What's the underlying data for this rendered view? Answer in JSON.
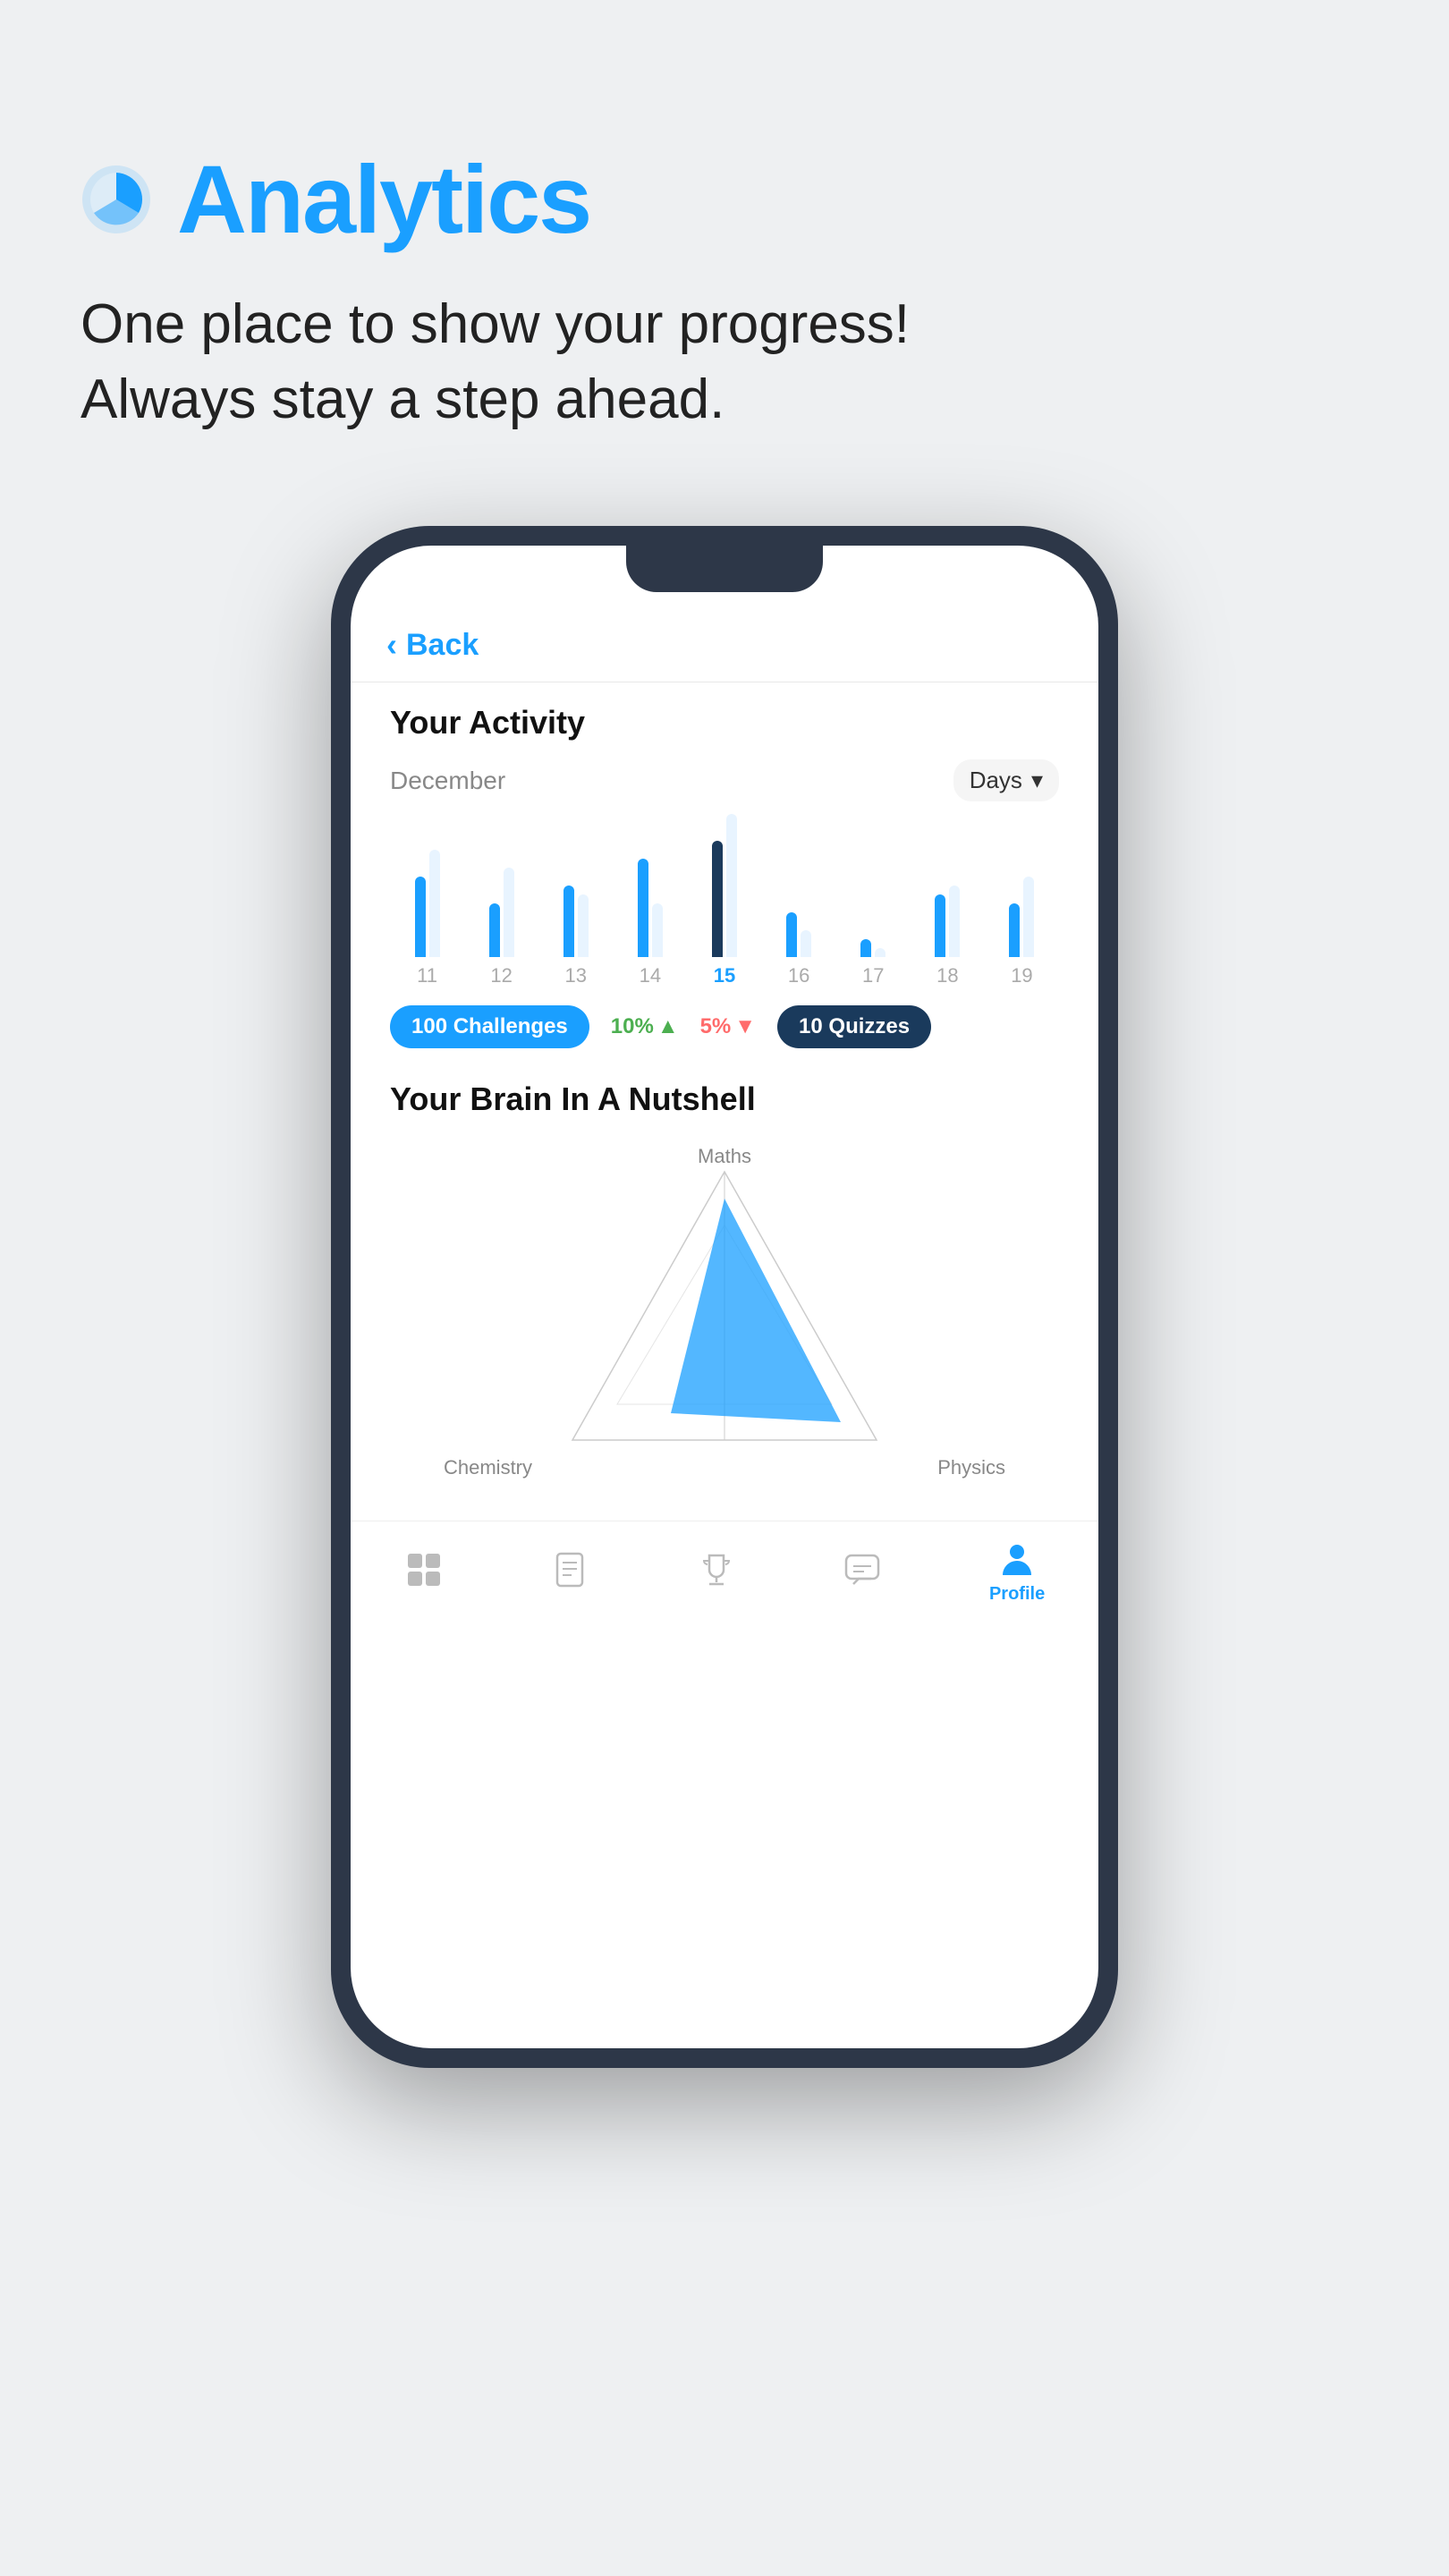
{
  "header": {
    "title": "Analytics",
    "subtitle_line1": "One place to show your progress!",
    "subtitle_line2": "Always stay a step ahead."
  },
  "phone": {
    "back_label": "Back",
    "activity": {
      "title": "Your Activity",
      "month": "December",
      "filter": "Days",
      "bars": [
        {
          "day": "11",
          "h1": 90,
          "h2": 120,
          "selected": false
        },
        {
          "day": "12",
          "h1": 60,
          "h2": 100,
          "selected": false
        },
        {
          "day": "13",
          "h1": 80,
          "h2": 70,
          "selected": false
        },
        {
          "day": "14",
          "h1": 110,
          "h2": 60,
          "selected": false
        },
        {
          "day": "15",
          "h1": 130,
          "h2": 160,
          "selected": true
        },
        {
          "day": "16",
          "h1": 50,
          "h2": 30,
          "selected": false
        },
        {
          "day": "17",
          "h1": 20,
          "h2": 10,
          "selected": false
        },
        {
          "day": "18",
          "h1": 70,
          "h2": 80,
          "selected": false
        },
        {
          "day": "19",
          "h1": 60,
          "h2": 90,
          "selected": false
        }
      ],
      "stats": {
        "challenges_count": "100",
        "challenges_label": "Challenges",
        "pct_up": "10%",
        "pct_down": "5%",
        "quizzes_count": "10",
        "quizzes_label": "Quizzes"
      }
    },
    "brain": {
      "title": "Your Brain In A Nutshell",
      "labels": {
        "top": "Maths",
        "left": "Chemistry",
        "right": "Physics"
      }
    },
    "nav": {
      "items": [
        {
          "icon": "grid-icon",
          "label": "",
          "active": false
        },
        {
          "icon": "book-icon",
          "label": "",
          "active": false
        },
        {
          "icon": "trophy-icon",
          "label": "",
          "active": false
        },
        {
          "icon": "chat-icon",
          "label": "",
          "active": false
        },
        {
          "icon": "profile-icon",
          "label": "Profile",
          "active": true
        }
      ]
    }
  }
}
